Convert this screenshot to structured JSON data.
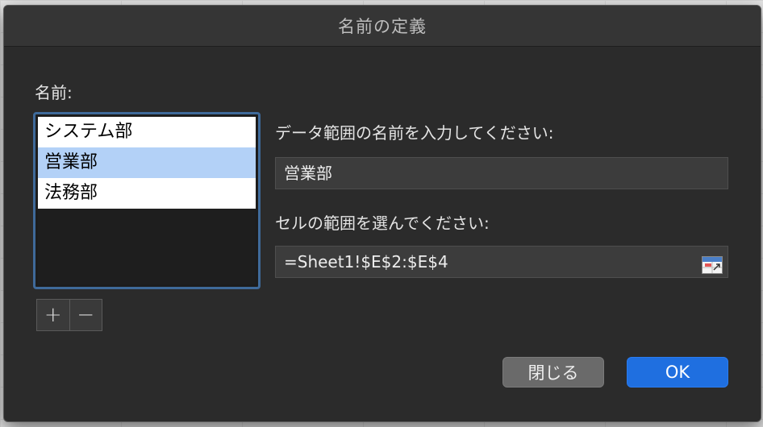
{
  "dialog": {
    "title": "名前の定義",
    "name_label": "名前:",
    "names_list": [
      {
        "label": "システム部",
        "selected": false
      },
      {
        "label": "営業部",
        "selected": true
      },
      {
        "label": "法務部",
        "selected": false
      }
    ],
    "add_label": "+",
    "remove_label": "−",
    "range_name_prompt": "データ範囲の名前を入力してください:",
    "range_name_value": "営業部",
    "cell_range_prompt": "セルの範囲を選んでください:",
    "cell_range_value": "=Sheet1!$E$2:$E$4",
    "close_label": "閉じる",
    "ok_label": "OK"
  },
  "colors": {
    "accent": "#1f6fe0",
    "selection": "#b3d1f7",
    "dialog_bg": "#2b2b2b"
  },
  "icons": {
    "range_picker": "range-select-icon"
  }
}
